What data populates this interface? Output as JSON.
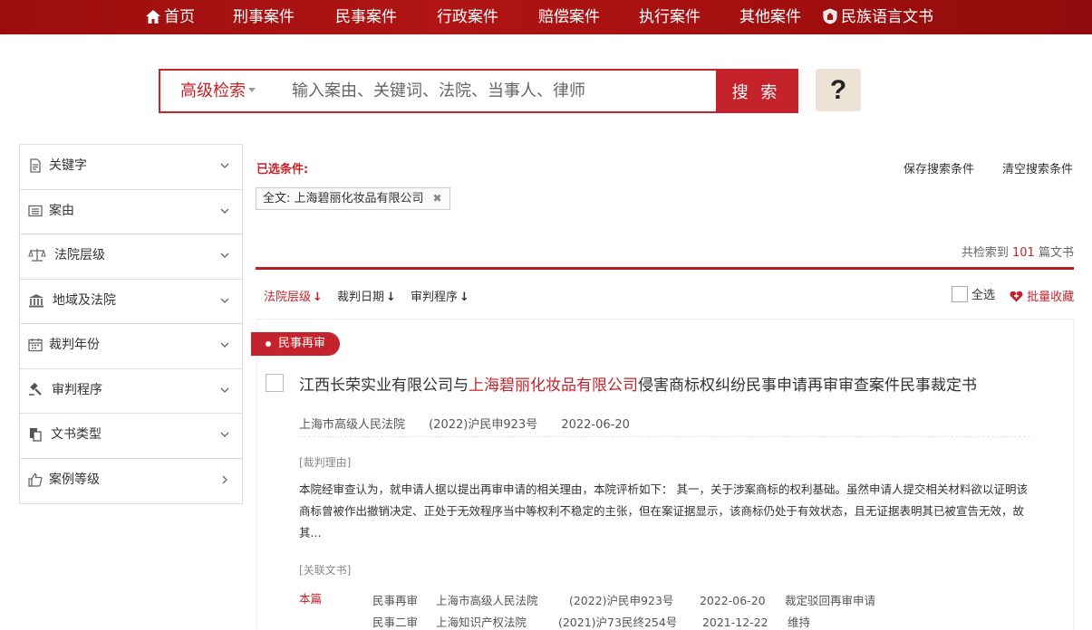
{
  "nav": {
    "home": "首页",
    "items": [
      "刑事案件",
      "民事案件",
      "行政案件",
      "赔偿案件",
      "执行案件",
      "其他案件"
    ],
    "ethnic": "民族语言文书"
  },
  "search": {
    "advanced": "高级检索",
    "placeholder": "输入案由、关键词、法院、当事人、律师",
    "button": "搜 索",
    "help": "?"
  },
  "sidebar": {
    "items": [
      {
        "label": "关键字",
        "icon": "document-icon"
      },
      {
        "label": "案由",
        "icon": "list-icon"
      },
      {
        "label": "法院层级",
        "icon": "scale-icon"
      },
      {
        "label": "地域及法院",
        "icon": "courthouse-icon"
      },
      {
        "label": "裁判年份",
        "icon": "calendar-icon"
      },
      {
        "label": "审判程序",
        "icon": "gavel-icon"
      },
      {
        "label": "文书类型",
        "icon": "files-icon"
      },
      {
        "label": "案例等级",
        "icon": "thumbs-up-icon"
      }
    ]
  },
  "filters": {
    "selected_label": "已选条件:",
    "save": "保存搜索条件",
    "clear": "清空搜索条件",
    "chip": "全文:  上海碧丽化妆品有限公司",
    "chip_remove": "✖"
  },
  "results": {
    "count_prefix": "共检索到",
    "count": "101",
    "count_suffix": "篇文书"
  },
  "sort": {
    "court_level": "法院层级",
    "date": "裁判日期",
    "procedure": "审判程序",
    "arrow": "↓",
    "select_all": "全选",
    "batch_fav": "批量收藏"
  },
  "case": {
    "tag": "民事再审",
    "title_pre": "江西长荣实业有限公司与",
    "title_hl": "上海碧丽化妆品有限公司",
    "title_post": "侵害商标权纠纷民事申请再审审查案件民事裁定书",
    "court": "上海市高级人民法院",
    "number": "(2022)沪民申923号",
    "date": "2022-06-20",
    "reason_label": "[裁判理由]",
    "reason": "本院经审查认为，就申请人据以提出再审申请的相关理由，本院评析如下：  其一，关于涉案商标的权利基础。虽然申请人提交相关材料欲以证明该商标曾被作出撤销决定、正处于无效程序当中等权利不稳定的主张，但在案证据显示，该商标仍处于有效状态，且无证据表明其已被宣告无效，故其...",
    "related_label": "[关联文书]",
    "this_label": "本篇",
    "related": [
      {
        "type": "民事再审",
        "court": "上海市高级人民法院",
        "number": "(2022)沪民申923号",
        "date": "2022-06-20",
        "result": "裁定驳回再审申请"
      },
      {
        "type": "民事二审",
        "court": "上海知识产权法院",
        "number": "(2021)沪73民终254号",
        "date": "2021-12-22",
        "result": "维持"
      }
    ]
  }
}
